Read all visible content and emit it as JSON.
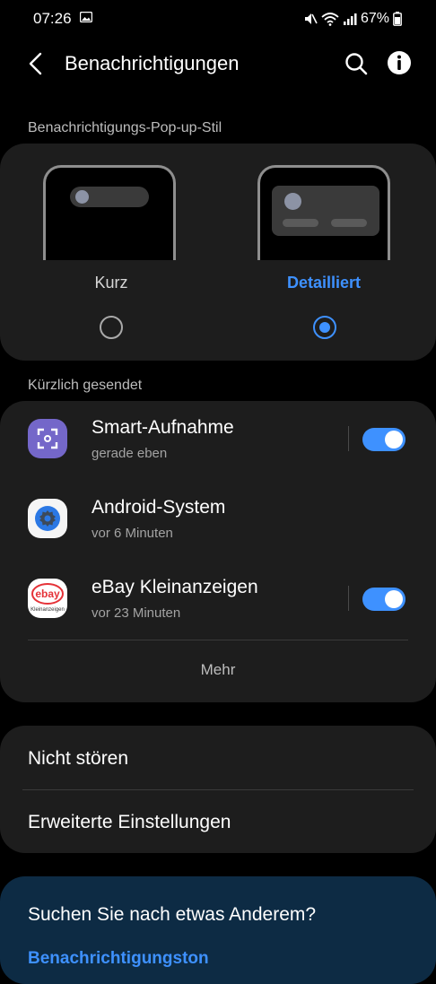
{
  "status_bar": {
    "time": "07:26",
    "battery": "67%"
  },
  "header": {
    "title": "Benachrichtigungen"
  },
  "popup_style": {
    "section_label": "Benachrichtigungs-Pop-up-Stil",
    "options": [
      {
        "label": "Kurz",
        "selected": false
      },
      {
        "label": "Detailliert",
        "selected": true
      }
    ]
  },
  "recent": {
    "section_label": "Kürzlich gesendet",
    "apps": [
      {
        "name": "Smart-Aufnahme",
        "time": "gerade eben",
        "toggle": true
      },
      {
        "name": "Android-System",
        "time": "vor 6 Minuten",
        "toggle": null
      },
      {
        "name": "eBay Kleinanzeigen",
        "time": "vor 23 Minuten",
        "toggle": true
      }
    ],
    "ebay_logo_text": "ebay",
    "ebay_logo_sub": "Kleinanzeigen",
    "more_label": "Mehr"
  },
  "settings": {
    "items": [
      "Nicht stören",
      "Erweiterte Einstellungen"
    ]
  },
  "suggestion": {
    "title": "Suchen Sie nach etwas Anderem?",
    "link": "Benachrichtigungston"
  },
  "colors": {
    "accent": "#3e91ff",
    "card": "#1d1d1d",
    "suggest_bg": "#0d2b44"
  }
}
